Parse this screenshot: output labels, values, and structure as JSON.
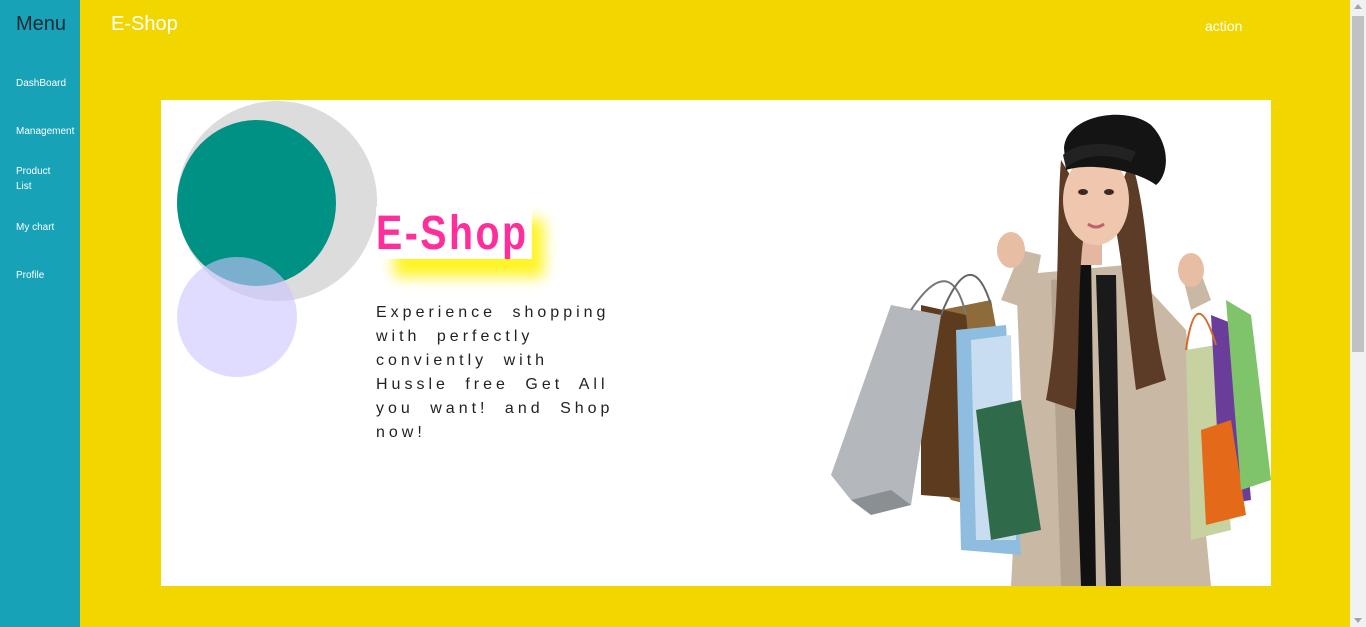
{
  "sidebar": {
    "title": "Menu",
    "items": [
      {
        "label": "DashBoard"
      },
      {
        "label": "Management"
      },
      {
        "label": "Product List"
      },
      {
        "label": "My chart"
      },
      {
        "label": "Profile"
      }
    ]
  },
  "header": {
    "brand": "E-Shop",
    "action_label": "action"
  },
  "banner": {
    "logo_text": "E-Shop",
    "tagline": "Experience shopping with perfectly conviently with Hussle free Get All you want! and Shop now!"
  },
  "colors": {
    "background": "#f2d600",
    "sidebar": "#17a2b8",
    "logo": "#ff2e9a",
    "accent_teal": "#009185"
  }
}
